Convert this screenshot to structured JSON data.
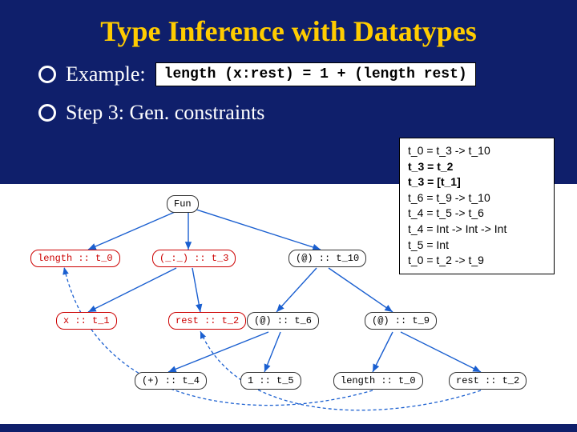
{
  "title": "Type Inference with Datatypes",
  "example_label": "Example:",
  "example_code": "length (x:rest) = 1 + (length rest)",
  "step_label": "Step 3: Gen. constraints",
  "constraints": [
    {
      "text": "t_0 = t_3 -> t_10",
      "bold": false
    },
    {
      "text": "t_3 = t_2",
      "bold": true
    },
    {
      "text": "t_3 = [t_1]",
      "bold": true
    },
    {
      "text": "t_6 = t_9 -> t_10",
      "bold": false
    },
    {
      "text": "t_4 = t_5 -> t_6",
      "bold": false
    },
    {
      "text": "t_4 = Int -> Int -> Int",
      "bold": false
    },
    {
      "text": "t_5 = Int",
      "bold": false
    },
    {
      "text": "t_0 = t_2 -> t_9",
      "bold": false
    }
  ],
  "nodes": {
    "fun": "Fun",
    "length_t0": "length :: t_0",
    "cons_t3": "(_:_) :: t_3",
    "app_t10": "(@) :: t_10",
    "x_t1": "x :: t_1",
    "rest_t2": "rest :: t_2",
    "app_t6": "(@) :: t_6",
    "app_t9": "(@) :: t_9",
    "plus_t4": "(+) :: t_4",
    "one_t5": "1 :: t_5",
    "length_t0b": "length :: t_0",
    "rest_t2b": "rest :: t_2"
  },
  "chart_data": {
    "type": "diagram",
    "description": "Parse/type tree for length (x:rest) = 1 + (length rest) with type-variable annotations and generated unification constraints",
    "tree_edges": [
      [
        "Fun",
        "length :: t_0"
      ],
      [
        "Fun",
        "(_:_) :: t_3"
      ],
      [
        "Fun",
        "(@) :: t_10"
      ],
      [
        "(_:_) :: t_3",
        "x :: t_1"
      ],
      [
        "(_:_) :: t_3",
        "rest :: t_2"
      ],
      [
        "(@) :: t_10",
        "(@) :: t_6"
      ],
      [
        "(@) :: t_10",
        "(@) :: t_9"
      ],
      [
        "(@) :: t_6",
        "(+) :: t_4"
      ],
      [
        "(@) :: t_6",
        "1 :: t_5"
      ],
      [
        "(@) :: t_9",
        "length :: t_0"
      ],
      [
        "(@) :: t_9",
        "rest :: t_2"
      ]
    ],
    "dashed_refs": [
      [
        "length :: t_0 (leaf)",
        "length :: t_0 (def)"
      ],
      [
        "rest :: t_2 (leaf)",
        "rest :: t_2 (pattern)"
      ]
    ]
  }
}
